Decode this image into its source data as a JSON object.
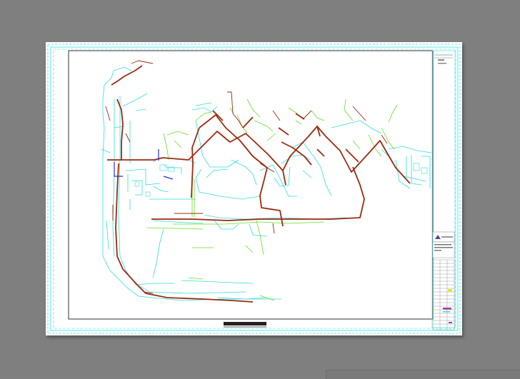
{
  "app": {
    "viewport": "drawing-viewport"
  },
  "sheet": {
    "paper_color": "#ffffff",
    "frame_color": "#33e0e0",
    "border_color": "#1a1a1a"
  },
  "layers": {
    "cyan": "#33dcdc",
    "red": "#9b2a10",
    "green": "#66dd22",
    "blue": "#2233cc",
    "purple": "#aa33aa",
    "yellow": "#e6e633"
  },
  "title_block": {
    "logo_label": "logo"
  }
}
